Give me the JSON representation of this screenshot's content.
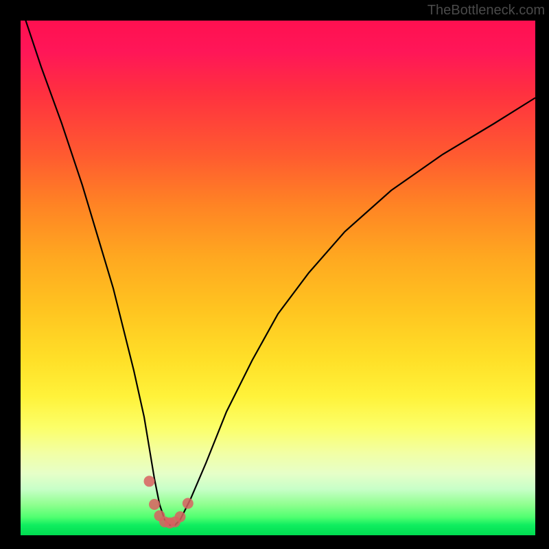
{
  "watermark": "TheBottleneck.com",
  "chart_data": {
    "type": "line",
    "title": "",
    "xlabel": "",
    "ylabel": "",
    "xlim": [
      0,
      100
    ],
    "ylim": [
      0,
      100
    ],
    "series": [
      {
        "name": "bottleneck-curve",
        "x": [
          0,
          4,
          8,
          12,
          15,
          18,
          20,
          22,
          24,
          25,
          26,
          27,
          28,
          29,
          30,
          31,
          33,
          36,
          40,
          45,
          50,
          56,
          63,
          72,
          82,
          92,
          100
        ],
        "y": [
          103,
          91,
          80,
          68,
          58,
          48,
          40,
          32,
          23,
          17,
          11,
          6,
          3,
          2,
          2,
          3,
          7,
          14,
          24,
          34,
          43,
          51,
          59,
          67,
          74,
          80,
          85
        ]
      }
    ],
    "points": {
      "name": "highlight-dots",
      "x": [
        25.0,
        26.0,
        27.0,
        28.0,
        29.0,
        30.0,
        31.0,
        32.5
      ],
      "y": [
        10.5,
        6.0,
        3.8,
        2.6,
        2.4,
        2.6,
        3.6,
        6.2
      ]
    },
    "gradient_bands": [
      "#ff1050",
      "#ff5a30",
      "#ffc420",
      "#fcff68",
      "#50ff70",
      "#00dc50"
    ]
  }
}
